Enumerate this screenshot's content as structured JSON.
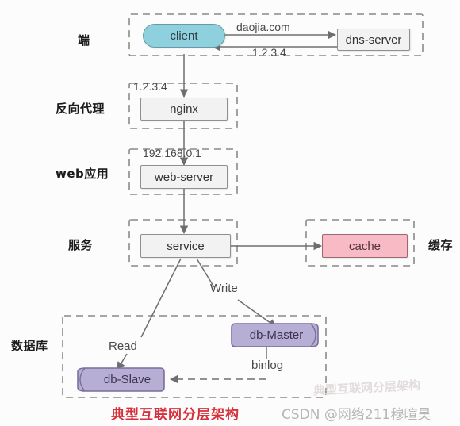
{
  "diagram": {
    "caption": "典型互联网分层架构",
    "watermark": "CSDN @网络211穆暄昊",
    "watermark_faint": "典型互联网分层架构",
    "colors": {
      "client_fill": "#8ed0de",
      "client_stroke": "#6a9aa6",
      "box_fill": "#f2f2f2",
      "box_stroke": "#8f8f8f",
      "cache_fill": "#f8bac4",
      "cache_stroke": "#9a6a72",
      "db_fill": "#b6aed4",
      "db_stroke": "#7a6f9c",
      "dashed_stroke": "#8a8a8a",
      "arrow_stroke": "#6e6e6e",
      "caption_color": "#d6313b"
    },
    "tiers": [
      {
        "id": "client-tier",
        "label": "端"
      },
      {
        "id": "reverse-proxy-tier",
        "label": "反向代理"
      },
      {
        "id": "web-app-tier",
        "label": "web应用"
      },
      {
        "id": "service-tier",
        "label": "服务"
      },
      {
        "id": "cache-tier",
        "label": "缓存"
      },
      {
        "id": "database-tier",
        "label": "数据库"
      }
    ],
    "nodes": [
      {
        "id": "client",
        "label": "client",
        "shape": "pill"
      },
      {
        "id": "dns-server",
        "label": "dns-server",
        "shape": "rect"
      },
      {
        "id": "nginx",
        "label": "nginx",
        "shape": "rect"
      },
      {
        "id": "web-server",
        "label": "web-server",
        "shape": "rect"
      },
      {
        "id": "service",
        "label": "service",
        "shape": "rect"
      },
      {
        "id": "cache",
        "label": "cache",
        "shape": "rect"
      },
      {
        "id": "db-master",
        "label": "db-Master",
        "shape": "cylinder-right"
      },
      {
        "id": "db-slave",
        "label": "db-Slave",
        "shape": "cylinder-left"
      }
    ],
    "edge_labels": [
      {
        "id": "dns-query",
        "text": "daojia.com",
        "from": "client",
        "to": "dns-server"
      },
      {
        "id": "dns-reply",
        "text": "1.2.3.4",
        "from": "dns-server",
        "to": "client"
      },
      {
        "id": "client-to-nginx",
        "text": "1.2.3.4",
        "from": "client",
        "to": "nginx"
      },
      {
        "id": "nginx-to-web",
        "text": "192.168.0.1",
        "from": "nginx",
        "to": "web-server"
      },
      {
        "id": "service-write",
        "text": "Write",
        "from": "service",
        "to": "db-master"
      },
      {
        "id": "service-read",
        "text": "Read",
        "from": "service",
        "to": "db-slave"
      },
      {
        "id": "replication",
        "text": "binlog",
        "from": "db-master",
        "to": "db-slave"
      }
    ]
  }
}
